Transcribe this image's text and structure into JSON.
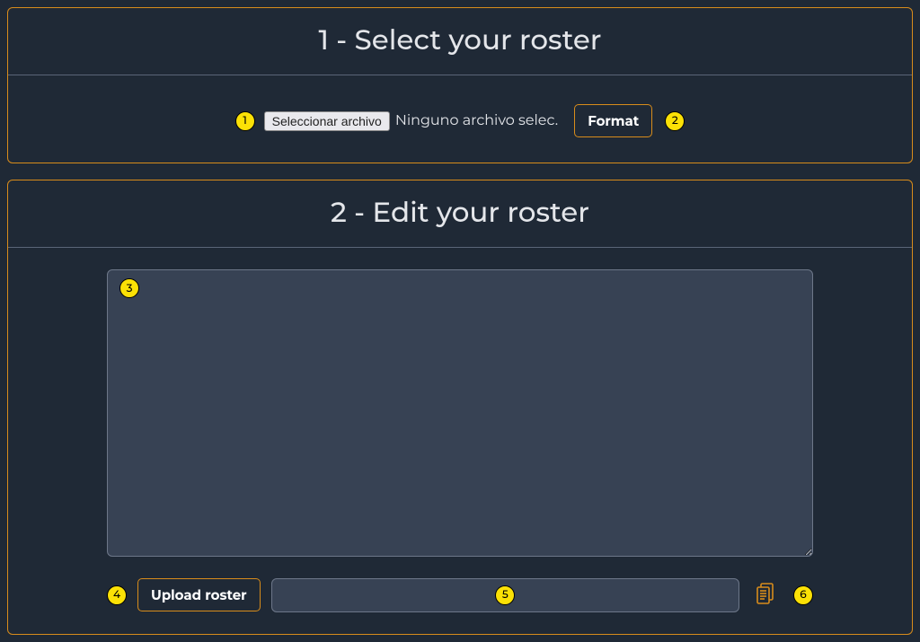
{
  "step1": {
    "title": "1 - Select your roster",
    "badge_file": "1",
    "file_button": "Seleccionar archivo",
    "file_status": "Ninguno archivo selec.",
    "format_button": "Format",
    "badge_format": "2"
  },
  "step2": {
    "title": "2 - Edit your roster",
    "badge_textarea": "3",
    "textarea_value": "",
    "badge_upload": "4",
    "upload_button": "Upload roster",
    "badge_url": "5",
    "url_value": "",
    "badge_copy": "6"
  }
}
